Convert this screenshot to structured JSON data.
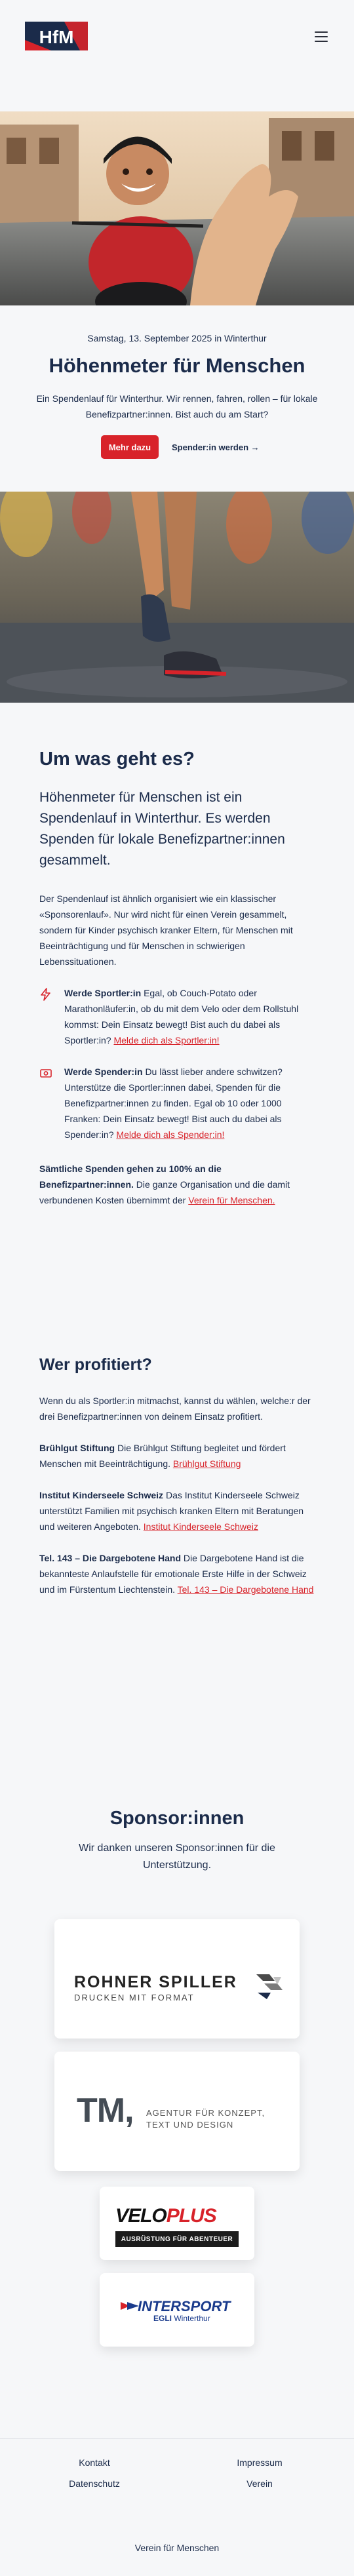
{
  "header": {
    "logo_text": "HfM",
    "menu_icon": "hamburger-icon"
  },
  "hero": {
    "image_alt": "Lachender Velofahrer mit Helm gibt ein High-Five",
    "date": "Samstag, 13. September 2025 in Winterthur",
    "title": "Höhenmeter für Menschen",
    "lead": "Ein Spendenlauf für Winterthur. Wir rennen, fahren, rollen – für lokale Benefizpartner:innen. Bist auch du am Start?",
    "primary_button": "Mehr dazu",
    "secondary_button": "Spender:in werden →"
  },
  "running_image_alt": "Läufer:innen auf nasser Strasse",
  "about": {
    "heading": "Um was geht es?",
    "lead": "Höhenmeter für Menschen ist ein Spendenlauf in Winterthur. Es werden Spenden für lokale Benefizpartner:innen gesammelt.",
    "paragraph": "Der Spendenlauf ist ähnlich organisiert wie ein klassischer «Sponsorenlauf». Nur wird nicht für einen Verein gesammelt, sondern für Kinder psychisch kranker Eltern, für Menschen mit Beeinträchtigung und für Menschen in schwierigen Lebenssituationen.",
    "athlete_title": "Werde Sportler:in",
    "athlete_text": "Egal, ob Couch-Potato oder Marathonläufer:in, ob du mit dem Velo oder dem Rollstuhl kommst: Dein Einsatz bewegt! Bist auch du dabei als Sportler:in?",
    "athlete_link": "Melde dich als Sportler:in!",
    "donor_title": "Werde Spender:in",
    "donor_text": "Du lässt lieber andere schwitzen? Unterstütze die Sportler:innen dabei, Spenden für die Benefizpartner:innen zu finden. Egal ob 10 oder 1000 Franken: Dein Einsatz bewegt! Bist auch du dabei als Spender:in?",
    "donor_link": "Melde dich als Spender:in!",
    "note_bold": "Sämtliche Spenden gehen zu 100% an die Benefizpartner:innen.",
    "note_text": "Die ganze Organisation und die damit verbundenen Kosten übernimmt der",
    "note_link": "Verein für Menschen."
  },
  "beneficiaries": {
    "heading": "Wer profitiert?",
    "intro": "Wenn du als Sportler:in mitmachst, kannst du wählen, welche:r der drei Benefizpartner:innen von deinem Einsatz profitiert.",
    "items": [
      {
        "name": "Brühlgut Stiftung",
        "text": "Die Brühlgut Stiftung begleitet und fördert Menschen mit Beeinträchtigung.",
        "link": "Brühlgut Stiftung"
      },
      {
        "name": "Institut Kinderseele Schweiz",
        "text": "Das Institut Kinderseele Schweiz unterstützt Familien mit psychisch kranken Eltern mit Beratungen und weiteren Angeboten.",
        "link": "Institut Kinderseele Schweiz"
      },
      {
        "name": "Tel. 143 – Die Dargebotene Hand",
        "text": "Die Dargebotene Hand ist die bekannteste Anlaufstelle für emotionale Erste Hilfe in der Schweiz und im Fürstentum Liechtenstein.",
        "link": "Tel. 143 – Die Dargebotene Hand"
      }
    ]
  },
  "sponsors": {
    "heading": "Sponsor:innen",
    "subheading": "Wir danken unseren Sponsor:innen für die Unterstützung.",
    "rohner_name": "ROHNER SPILLER",
    "rohner_tag": "DRUCKEN MIT FORMAT",
    "tm_name": "TM,",
    "tm_tag1": "AGENTUR FÜR KONZEPT,",
    "tm_tag2": "TEXT UND DESIGN",
    "veloplus_a": "VELO",
    "veloplus_b": "PLUS",
    "veloplus_tag": "AUSRÜSTUNG FÜR ABENTEUER",
    "intersport": "INTERSPORT",
    "intersport_sub_a": "EGLI",
    "intersport_sub_b": "Winterthur"
  },
  "footer": {
    "links": [
      "Kontakt",
      "Impressum",
      "Datenschutz",
      "Verein"
    ],
    "bottom": "Verein für Menschen"
  },
  "colors": {
    "brand_red": "#d8232a",
    "navy": "#1b2b4a",
    "background": "#f6f7f9"
  }
}
